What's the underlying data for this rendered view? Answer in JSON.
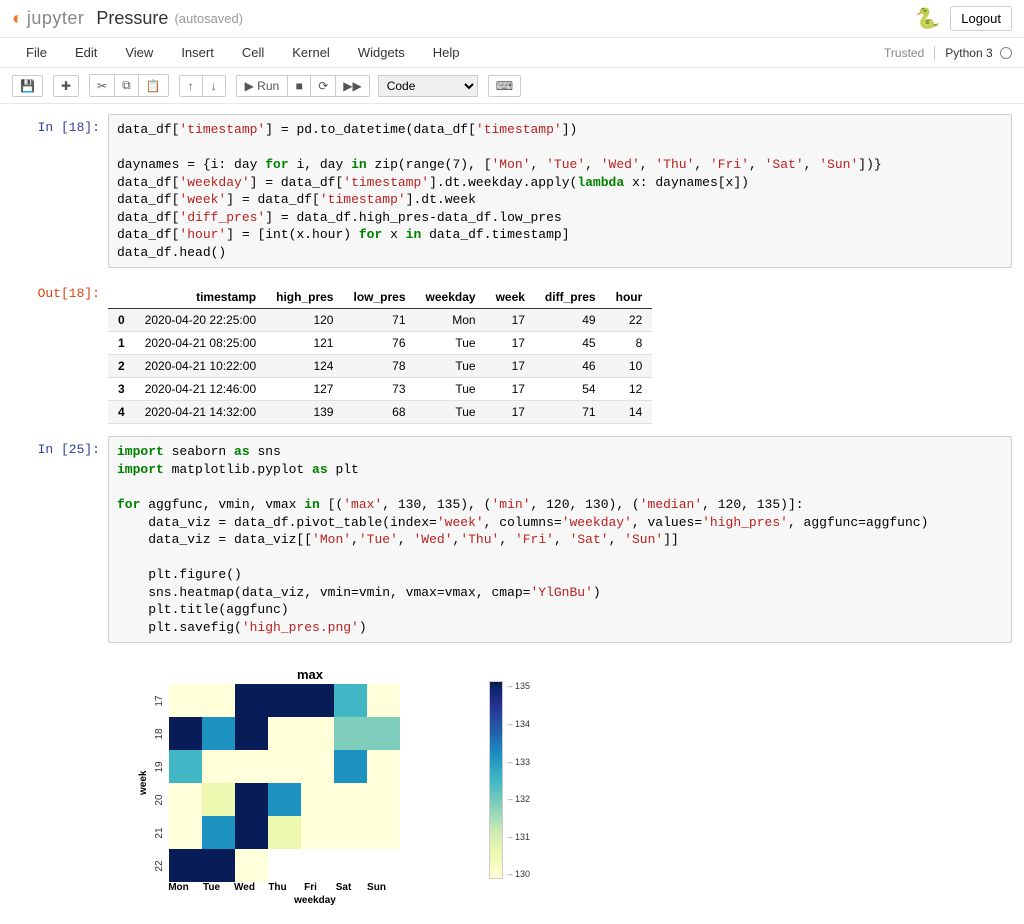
{
  "header": {
    "title": "Pressure",
    "autosave": "(autosaved)",
    "logout": "Logout",
    "jupyter": "jupyter"
  },
  "menubar": {
    "items": [
      "File",
      "Edit",
      "View",
      "Insert",
      "Cell",
      "Kernel",
      "Widgets",
      "Help"
    ],
    "trusted": "Trusted",
    "kernel": "Python 3"
  },
  "toolbar": {
    "save_icon": "💾",
    "add_icon": "✚",
    "cut_icon": "✂",
    "copy_icon": "⧉",
    "paste_icon": "📋",
    "up_icon": "↑",
    "down_icon": "↓",
    "run_label": "▶ Run",
    "stop_icon": "■",
    "restart_icon": "⟳",
    "ff_icon": "▶▶",
    "cell_type": "Code",
    "cmd_icon": "⌨"
  },
  "cells": {
    "c1_prompt": "In [18]:",
    "c1_out_prompt": "Out[18]:",
    "c2_prompt": "In [25]:"
  },
  "table": {
    "cols": [
      "timestamp",
      "high_pres",
      "low_pres",
      "weekday",
      "week",
      "diff_pres",
      "hour"
    ],
    "rows": [
      {
        "idx": "0",
        "timestamp": "2020-04-20 22:25:00",
        "high_pres": "120",
        "low_pres": "71",
        "weekday": "Mon",
        "week": "17",
        "diff_pres": "49",
        "hour": "22"
      },
      {
        "idx": "1",
        "timestamp": "2020-04-21 08:25:00",
        "high_pres": "121",
        "low_pres": "76",
        "weekday": "Tue",
        "week": "17",
        "diff_pres": "45",
        "hour": "8"
      },
      {
        "idx": "2",
        "timestamp": "2020-04-21 10:22:00",
        "high_pres": "124",
        "low_pres": "78",
        "weekday": "Tue",
        "week": "17",
        "diff_pres": "46",
        "hour": "10"
      },
      {
        "idx": "3",
        "timestamp": "2020-04-21 12:46:00",
        "high_pres": "127",
        "low_pres": "73",
        "weekday": "Tue",
        "week": "17",
        "diff_pres": "54",
        "hour": "12"
      },
      {
        "idx": "4",
        "timestamp": "2020-04-21 14:32:00",
        "high_pres": "139",
        "low_pres": "68",
        "weekday": "Tue",
        "week": "17",
        "diff_pres": "71",
        "hour": "14"
      }
    ]
  },
  "chart_data": {
    "type": "heatmap",
    "title": "max",
    "xlabel": "weekday",
    "ylabel": "week",
    "x_categories": [
      "Mon",
      "Tue",
      "Wed",
      "Thu",
      "Fri",
      "Sat",
      "Sun"
    ],
    "y_categories": [
      "17",
      "18",
      "19",
      "20",
      "21",
      "22"
    ],
    "vmin": 130,
    "vmax": 135,
    "colorbar_ticks": [
      "135",
      "134",
      "133",
      "132",
      "131",
      "130"
    ],
    "values": [
      [
        130,
        130,
        135,
        135,
        135,
        133,
        130
      ],
      [
        135,
        134,
        135,
        130,
        130,
        132,
        132
      ],
      [
        133,
        130,
        130,
        130,
        130,
        134,
        130
      ],
      [
        130,
        131,
        135,
        134,
        130,
        130,
        130
      ],
      [
        130,
        134,
        135,
        131,
        130,
        130,
        130
      ],
      [
        135,
        135,
        130,
        null,
        null,
        null,
        null
      ]
    ],
    "cmap": "YlGnBu"
  }
}
